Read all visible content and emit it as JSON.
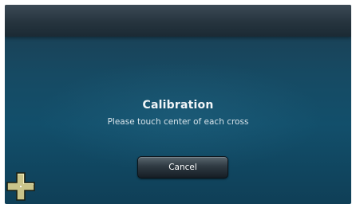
{
  "dialog": {
    "title": "Calibration",
    "instruction": "Please touch center of each cross",
    "cancel_label": "Cancel"
  },
  "icons": {
    "calibration_target": "cross-icon"
  },
  "colors": {
    "background_top": "#1d3c4f",
    "background_bottom": "#0f3f57",
    "top_bar": "#26343e",
    "cross_fill": "#c9c48a",
    "text": "#f2f6f8"
  }
}
